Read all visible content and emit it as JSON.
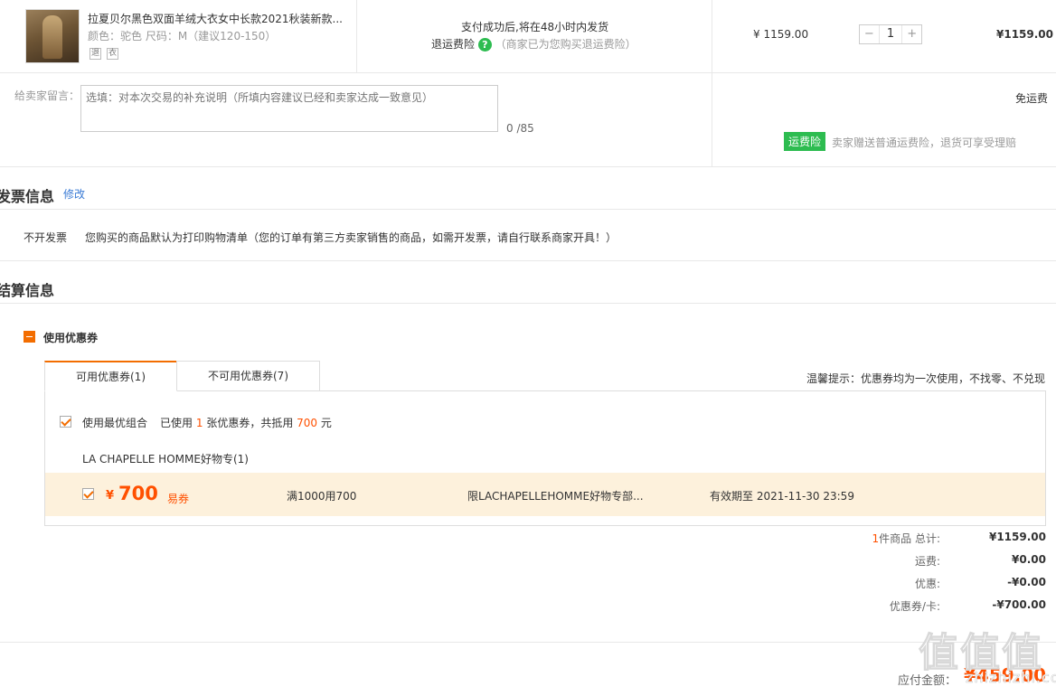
{
  "item": {
    "title": "拉夏贝尔黑色双面羊绒大衣女中长款2021秋装新款...",
    "spec": "颜色：驼色   尺码：M（建议120-150）",
    "svc_icons": [
      "退",
      "衣"
    ],
    "ship_note": "支付成功后,将在48小时内发货",
    "insurance_label": "退运费险",
    "insurance_note": "（商家已为您购买退运费险）",
    "unit_price": "¥ 1159.00",
    "qty_minus": "−",
    "qty": "1",
    "qty_plus": "+",
    "subtotal": "¥1159.00"
  },
  "message": {
    "label": "给卖家留言：",
    "placeholder": "选填：对本次交易的补充说明（所填内容建议已经和卖家达成一致意见）",
    "counter": "0 /85"
  },
  "shipping": {
    "fee": "免运费",
    "tag": "运费险",
    "note": "卖家赠送普通运费险，退货可享受理赔"
  },
  "invoice": {
    "title": "发票信息",
    "edit": "修改",
    "type": "不开发票",
    "desc": "您购买的商品默认为打印购物清单（您的订单有第三方卖家销售的商品，如需开发票，请自行联系商家开具！）"
  },
  "settlement": {
    "title": "结算信息",
    "coupon_toggle": "使用优惠券",
    "tabs": [
      {
        "label": "可用优惠券(1)"
      },
      {
        "label": "不可用优惠券(7)"
      }
    ],
    "tip": "温馨提示：优惠券均为一次使用，不找零、不兑现",
    "best_combo": "使用最优组合",
    "used_pre": "已使用",
    "used_count": "1",
    "used_mid": "张优惠券，共抵用",
    "used_amount": "700",
    "used_unit": "元",
    "shop": "LA CHAPELLE HOMME好物专(1)",
    "coupon": {
      "currency": "¥",
      "amount": "700",
      "kind": "易券",
      "condition": "满1000用700",
      "scope": "限LACHAPELLEHOMME好物专部...",
      "validity": "有效期至 2021-11-30 23:59"
    }
  },
  "summary": {
    "count": "1",
    "count_label": "件商品 总计:",
    "total": "¥1159.00",
    "shipping_label": "运费:",
    "shipping": "¥0.00",
    "discount_label": "优惠:",
    "discount": "-¥0.00",
    "coupon_label": "优惠券/卡:",
    "coupon": "-¥700.00",
    "payable_label": "应付金额：",
    "payable": "¥459.00"
  },
  "watermark": {
    "main": "值值值",
    "sub": "zhizhizhi.com"
  },
  "colors": {
    "accent": "#f36d00",
    "price": "#ff5000",
    "green": "#2dbc50",
    "coupon_bg": "#fdf1dc"
  }
}
